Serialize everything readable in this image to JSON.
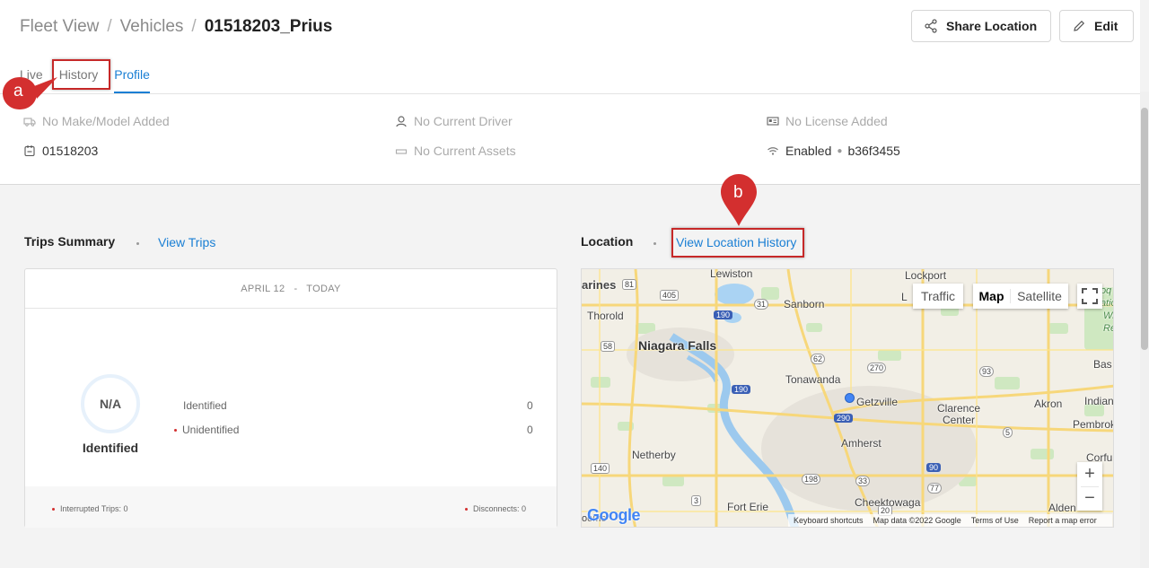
{
  "breadcrumb": {
    "root": "Fleet View",
    "parent": "Vehicles",
    "current": "01518203_Prius"
  },
  "actions": {
    "share_label": "Share Location",
    "edit_label": "Edit"
  },
  "tabs": [
    {
      "label": "Live"
    },
    {
      "label": "History"
    },
    {
      "label": "Profile",
      "active": true
    }
  ],
  "vehicle_info": {
    "make_model": "No Make/Model Added",
    "vehicle_id": "01518203",
    "driver": "No Current Driver",
    "assets": "No Current Assets",
    "license": "No License Added",
    "connectivity_status": "Enabled",
    "device_serial": "b36f3455"
  },
  "trips_summary": {
    "title": "Trips Summary",
    "link": "View Trips",
    "date_start": "APRIL 12",
    "date_end": "TODAY",
    "ring_value": "N/A",
    "ring_label": "Identified",
    "rows": [
      {
        "label": "Identified",
        "value": "0"
      },
      {
        "label": "Unidentified",
        "value": "0"
      }
    ],
    "interrupted": "Interrupted Trips: 0",
    "disconnects": "Disconnects: 0"
  },
  "location": {
    "title": "Location",
    "link": "View Location History",
    "map_controls": {
      "traffic": "Traffic",
      "map": "Map",
      "satellite": "Satellite",
      "zoom_in": "+",
      "zoom_out": "−"
    },
    "map_footer": {
      "shortcuts": "Keyboard shortcuts",
      "data": "Map data ©2022 Google",
      "terms": "Terms of Use",
      "report": "Report a map error"
    },
    "google": "Google",
    "places": {
      "lewiston": "Lewiston",
      "lockport": "Lockport",
      "marines": "arines",
      "thorold": "Thorold",
      "sanborn": "Sanborn",
      "niagara": "Niagara Falls",
      "tonawanda": "Tonawanda",
      "getzville": "Getzville",
      "clarence": "Clarence",
      "clarence2": "Center",
      "akron": "Akron",
      "indian": "Indian",
      "pembroke": "Pembroke",
      "amherst": "Amherst",
      "netherby": "Netherby",
      "cheektowaga": "Cheektowaga",
      "forterie": "Fort Erie",
      "alden": "Alden",
      "bas": "Bas",
      "corfu": "Corfu",
      "wild1": "Roq",
      "wild2": "Natio",
      "wild3": "Wild",
      "wild4": "Refu",
      "l": "L",
      "boom": "oome"
    },
    "routes": [
      "81",
      "405",
      "31",
      "190",
      "58",
      "62",
      "270",
      "93",
      "190",
      "290",
      "5",
      "140",
      "198",
      "33",
      "90",
      "3",
      "20",
      "77"
    ]
  },
  "annotations": {
    "a": "a",
    "b": "b"
  },
  "colors": {
    "accent": "#1a7fd4",
    "annotation": "#d32f2f"
  }
}
